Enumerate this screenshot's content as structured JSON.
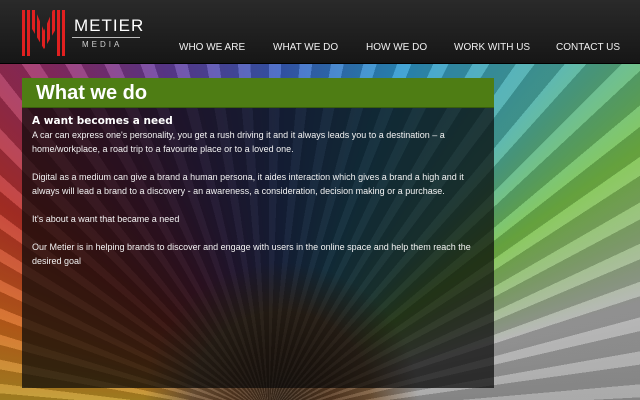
{
  "brand": {
    "name": "METIER",
    "tagline": "MEDIA",
    "logo_icon": "metier-m-logo-icon",
    "accent": "#e02020"
  },
  "nav": {
    "items": [
      {
        "label": "WHO WE ARE"
      },
      {
        "label": "WHAT WE DO"
      },
      {
        "label": "HOW WE DO"
      },
      {
        "label": "WORK WITH US"
      },
      {
        "label": "CONTACT US"
      }
    ]
  },
  "panel": {
    "title": "What we do",
    "title_bar_color": "#4e7d14",
    "subheading": "A want becomes a need",
    "paragraphs": [
      "A car can express one's personality, you get a rush driving it and it always leads you to a destination – a home/workplace, a road trip to a favourite place or to a loved one.",
      "Digital as a medium can give a brand a human persona, it aides interaction which gives a brand a high and it always will lead a brand to a discovery - an awareness, a consideration, decision making or a purchase.",
      "It's about a want that became a need",
      "Our Metier is in helping brands to discover and engage with users in the online space and help them reach the desired goal"
    ]
  }
}
